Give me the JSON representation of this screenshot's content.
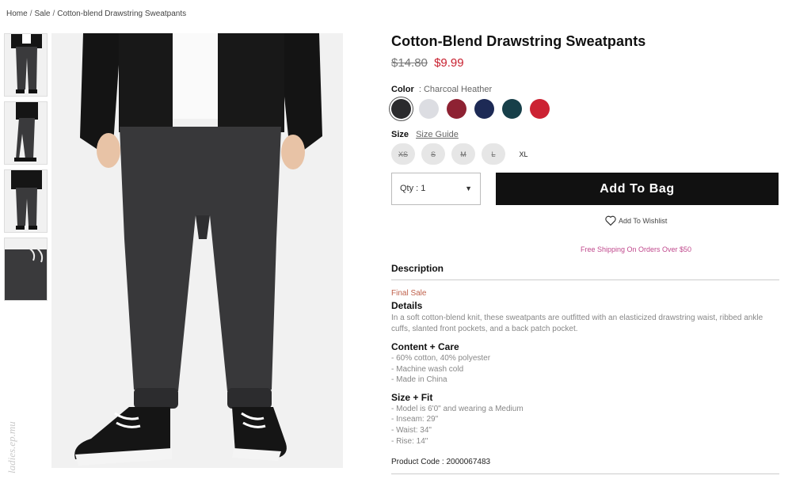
{
  "breadcrumb": {
    "home": "Home",
    "sep": "/",
    "sale": "Sale",
    "current": "Cotton-blend Drawstring Sweatpants"
  },
  "product": {
    "title": "Cotton-Blend Drawstring Sweatpants",
    "price_old": "$14.80",
    "price_new": "$9.99"
  },
  "color": {
    "label": "Color",
    "separator": ":",
    "selected": "Charcoal Heather",
    "swatches": [
      "#2b2b2d",
      "#dcdde2",
      "#8e2233",
      "#1d2a55",
      "#173f49",
      "#cc2233"
    ]
  },
  "size": {
    "label": "Size",
    "guide": "Size Guide",
    "options": [
      "XS",
      "S",
      "M",
      "L",
      "XL"
    ]
  },
  "qty": {
    "label": "Qty : 1",
    "caret": "▼"
  },
  "add_to_bag": "Add To Bag",
  "wishlist": "Add To Wishlist",
  "free_shipping": "Free Shipping On Orders Over $50",
  "description": {
    "heading": "Description",
    "final_sale": "Final Sale",
    "details_heading": "Details",
    "details_text": "In a soft cotton-blend knit, these sweatpants are outfitted with an elasticized drawstring waist, ribbed ankle cuffs, slanted front pockets, and a back patch pocket.",
    "content_heading": "Content + Care",
    "content_items": [
      "- 60% cotton, 40% polyester",
      "- Machine wash cold",
      "- Made in China"
    ],
    "fit_heading": "Size + Fit",
    "fit_items": [
      "- Model is 6'0\" and wearing a Medium",
      "- Inseam: 29\"",
      "- Waist: 34\"",
      "- Rise: 14\""
    ],
    "product_code": "Product Code : 2000067483"
  },
  "watermark": "ladies.ep.mu"
}
